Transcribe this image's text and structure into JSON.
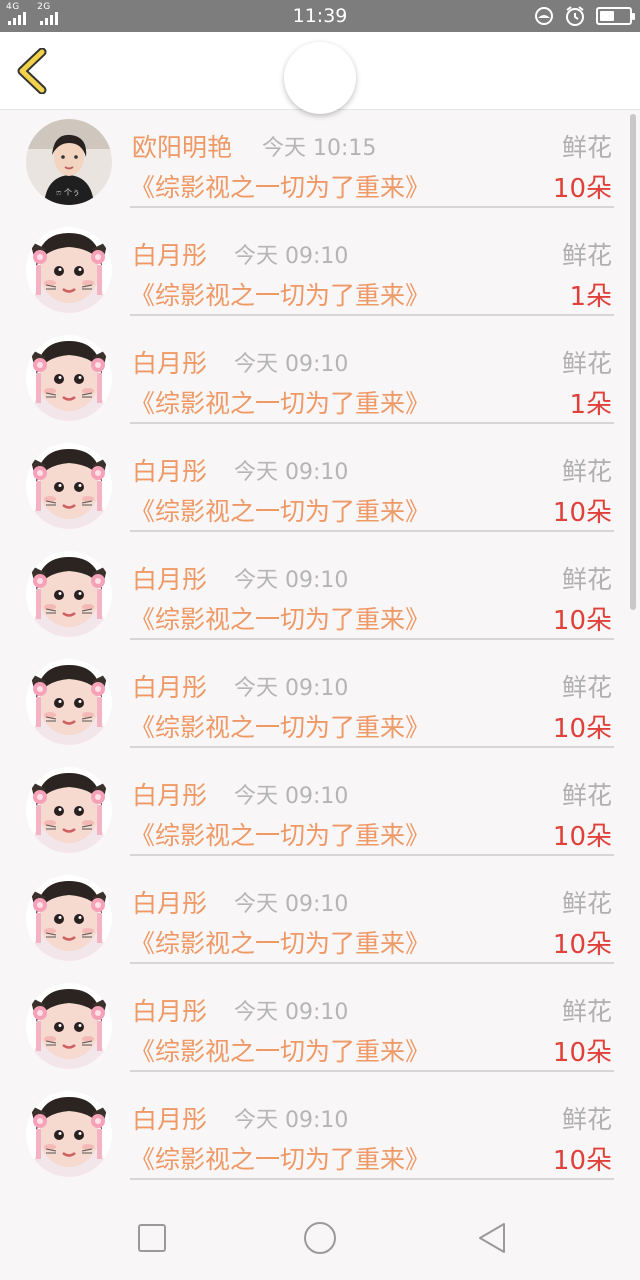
{
  "status_bar": {
    "network_label_1": "4G",
    "network_label_2": "2G",
    "time": "11:39",
    "icons": [
      "sim-icon",
      "alarm-icon",
      "battery-icon"
    ],
    "battery_level": 0.5
  },
  "header": {
    "back_icon": "chevron-left-icon",
    "accent_color": "#f1d24a"
  },
  "rows": [
    {
      "name": "欧阳明艳",
      "time": "今天 10:15",
      "gift_label": "鲜花",
      "book": "《综影视之一切为了重来》",
      "count": "10朵",
      "avatar": "avatar-woman"
    },
    {
      "name": "白月彤",
      "time": "今天 09:10",
      "gift_label": "鲜花",
      "book": "《综影视之一切为了重来》",
      "count": "1朵",
      "avatar": "avatar-child"
    },
    {
      "name": "白月彤",
      "time": "今天 09:10",
      "gift_label": "鲜花",
      "book": "《综影视之一切为了重来》",
      "count": "1朵",
      "avatar": "avatar-child"
    },
    {
      "name": "白月彤",
      "time": "今天 09:10",
      "gift_label": "鲜花",
      "book": "《综影视之一切为了重来》",
      "count": "10朵",
      "avatar": "avatar-child"
    },
    {
      "name": "白月彤",
      "time": "今天 09:10",
      "gift_label": "鲜花",
      "book": "《综影视之一切为了重来》",
      "count": "10朵",
      "avatar": "avatar-child"
    },
    {
      "name": "白月彤",
      "time": "今天 09:10",
      "gift_label": "鲜花",
      "book": "《综影视之一切为了重来》",
      "count": "10朵",
      "avatar": "avatar-child"
    },
    {
      "name": "白月彤",
      "time": "今天 09:10",
      "gift_label": "鲜花",
      "book": "《综影视之一切为了重来》",
      "count": "10朵",
      "avatar": "avatar-child"
    },
    {
      "name": "白月彤",
      "time": "今天 09:10",
      "gift_label": "鲜花",
      "book": "《综影视之一切为了重来》",
      "count": "10朵",
      "avatar": "avatar-child"
    },
    {
      "name": "白月彤",
      "time": "今天 09:10",
      "gift_label": "鲜花",
      "book": "《综影视之一切为了重来》",
      "count": "10朵",
      "avatar": "avatar-child"
    },
    {
      "name": "白月彤",
      "time": "今天 09:10",
      "gift_label": "鲜花",
      "book": "《综影视之一切为了重来》",
      "count": "10朵",
      "avatar": "avatar-child"
    }
  ],
  "colors": {
    "name": "#ee9966",
    "time": "#b5b5b5",
    "gift_label": "#b0b0b0",
    "count": "#e0403a"
  },
  "navbar": {
    "icons": [
      "square-recent-icon",
      "circle-home-icon",
      "triangle-back-icon"
    ]
  }
}
